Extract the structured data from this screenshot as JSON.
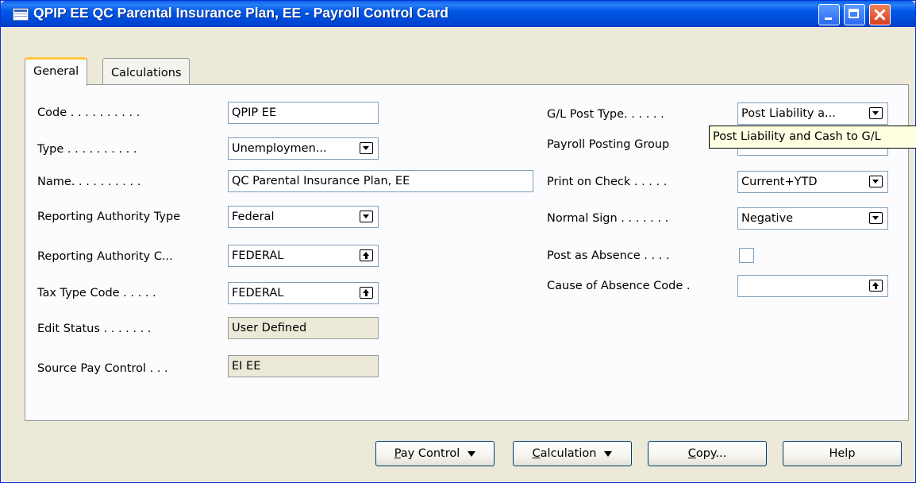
{
  "window": {
    "title": "QPIP EE QC Parental Insurance Plan, EE - Payroll Control Card",
    "icon": "form-icon"
  },
  "tabs": [
    {
      "label": "General",
      "active": true
    },
    {
      "label": "Calculations",
      "active": false
    }
  ],
  "left_fields": {
    "code": {
      "label": "Code . . . . . . . . . .",
      "value": "QPIP EE"
    },
    "type": {
      "label": "Type . . . . . . . . . .",
      "value": "Unemploymen..."
    },
    "name": {
      "label": "Name. . . . . . . . . .",
      "value": "QC Parental Insurance Plan, EE"
    },
    "reporting_authority_type": {
      "label": "Reporting Authority Type",
      "value": "Federal"
    },
    "reporting_authority_code": {
      "label": "Reporting Authority C...",
      "value": "FEDERAL"
    },
    "tax_type_code": {
      "label": "Tax Type Code . . . . .",
      "value": "FEDERAL"
    },
    "edit_status": {
      "label": "Edit Status . . . . . . .",
      "value": "User Defined"
    },
    "source_pay_control": {
      "label": "Source Pay Control . . .",
      "value": "EI EE"
    }
  },
  "right_fields": {
    "gl_post_type": {
      "label": "G/L Post Type. . . . . .",
      "value": "Post Liability a..."
    },
    "payroll_posting_group": {
      "label": "Payroll Posting Group",
      "value": ""
    },
    "print_on_check": {
      "label": "Print on Check . . . . .",
      "value": "Current+YTD"
    },
    "normal_sign": {
      "label": "Normal Sign . . . . . . .",
      "value": "Negative"
    },
    "post_as_absence": {
      "label": "Post as Absence . . . .",
      "checked": false
    },
    "cause_of_absence_code": {
      "label": "Cause of Absence Code .",
      "value": ""
    }
  },
  "tooltip": {
    "text": "Post Liability and Cash to G/L"
  },
  "buttons": {
    "pay_control": {
      "accel": "P",
      "rest": "ay Control"
    },
    "calculation": {
      "accel": "C",
      "rest": "alculation"
    },
    "copy": {
      "accel": "C",
      "rest": "opy..."
    },
    "help": {
      "label": "Help"
    }
  }
}
